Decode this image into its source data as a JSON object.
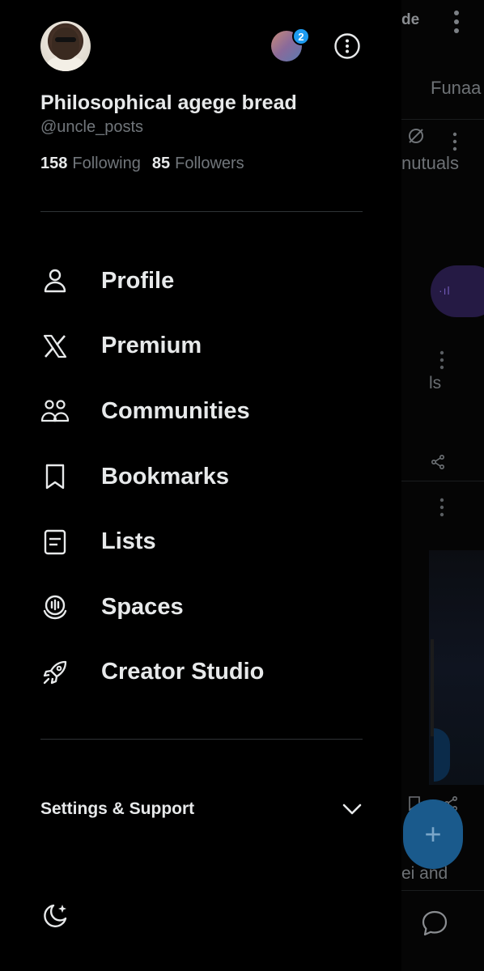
{
  "drawer": {
    "display_name": "Philosophical agege bread",
    "handle": "@uncle_posts",
    "following_count": "158",
    "following_label": "Following",
    "followers_count": "85",
    "followers_label": "Followers",
    "account_badge_count": "2",
    "menu": [
      {
        "label": "Profile",
        "icon": "person-icon"
      },
      {
        "label": "Premium",
        "icon": "x-logo-icon"
      },
      {
        "label": "Communities",
        "icon": "communities-icon"
      },
      {
        "label": "Bookmarks",
        "icon": "bookmark-icon"
      },
      {
        "label": "Lists",
        "icon": "list-icon"
      },
      {
        "label": "Spaces",
        "icon": "spaces-icon"
      },
      {
        "label": "Creator Studio",
        "icon": "rocket-icon"
      }
    ],
    "settings_label": "Settings & Support",
    "theme_icon": "moon-sparkle-icon"
  },
  "background": {
    "top_text": "de",
    "tab_text": "Funaa",
    "mutuals_text": "nutuals",
    "ls_text": "ls",
    "purple_glyph": "·ıl",
    "bottom_text": "ei and",
    "fab_symbol": "+"
  },
  "colors": {
    "background": "#000000",
    "text_primary": "#e7e9ea",
    "text_secondary": "#71767b",
    "divider": "#2f3336",
    "accent": "#1d9bf0"
  }
}
